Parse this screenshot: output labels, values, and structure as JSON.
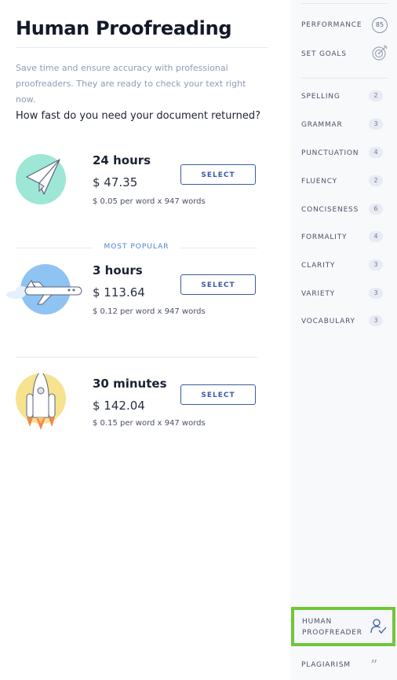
{
  "main": {
    "title": "Human Proofreading",
    "subtitle": "Save time and ensure accuracy with professional proofreaders. They are ready to check your text right now.",
    "question": "How fast do you need your document returned?",
    "popular_label": "MOST POPULAR",
    "options": [
      {
        "time": "24 hours",
        "price": "$ 47.35",
        "detail": "$ 0.05 per word x 947 words",
        "button": "SELECT",
        "icon": "paper-plane-icon"
      },
      {
        "time": "3 hours",
        "price": "$ 113.64",
        "detail": "$ 0.12 per word x 947 words",
        "button": "SELECT",
        "icon": "airplane-icon"
      },
      {
        "time": "30 minutes",
        "price": "$ 142.04",
        "detail": "$ 0.15 per word x 947 words",
        "button": "SELECT",
        "icon": "rocket-icon"
      }
    ]
  },
  "sidebar": {
    "performance": {
      "label": "PERFORMANCE",
      "score": "85"
    },
    "set_goals": {
      "label": "SET GOALS",
      "icon": "target-icon"
    },
    "categories": [
      {
        "label": "SPELLING",
        "count": "2"
      },
      {
        "label": "GRAMMAR",
        "count": "3"
      },
      {
        "label": "PUNCTUATION",
        "count": "4"
      },
      {
        "label": "FLUENCY",
        "count": "2"
      },
      {
        "label": "CONCISENESS",
        "count": "6"
      },
      {
        "label": "FORMALITY",
        "count": "4"
      },
      {
        "label": "CLARITY",
        "count": "3"
      },
      {
        "label": "VARIETY",
        "count": "3"
      },
      {
        "label": "VOCABULARY",
        "count": "3"
      }
    ],
    "human_proofreader": {
      "label": "HUMAN PROOFREADER",
      "icon": "person-check-icon"
    },
    "plagiarism": {
      "label": "PLAGIARISM",
      "icon": "quote-icon"
    }
  },
  "colors": {
    "accent": "#3c5aa6",
    "popular": "#4d7fd3",
    "highlight_border": "#72c63a"
  }
}
